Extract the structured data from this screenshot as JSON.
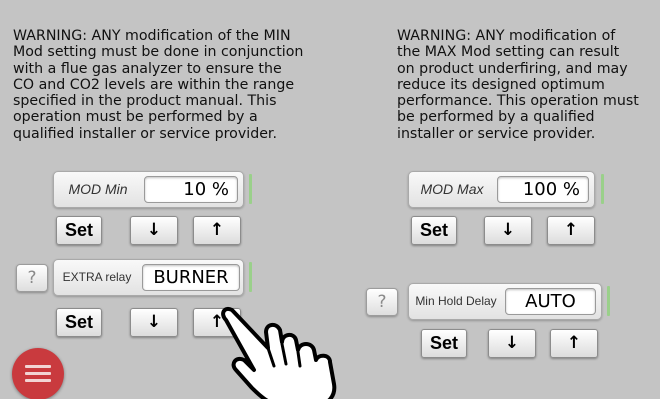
{
  "warnings": {
    "min": "WARNING: ANY modification of the MIN\nMod setting must be done in conjunction\nwith a flue gas analyzer to ensure the\nCO and CO2 levels are within the range\nspecified in the product manual. This\noperation must be performed by a\nqualified installer or service provider.",
    "max": "WARNING: ANY modification of\nthe MAX Mod setting can result\non product underfiring, and may\nreduce its designed optimum\nperformance. This operation must\nbe performed by a qualified\ninstaller or service provider."
  },
  "mod_min": {
    "label": "MOD Min",
    "value": "10 %"
  },
  "mod_max": {
    "label": "MOD Max",
    "value": "100 %"
  },
  "extra_relay": {
    "label": "EXTRA relay",
    "value": "BURNER"
  },
  "min_hold_delay": {
    "label": "Min Hold Delay",
    "value": "AUTO"
  },
  "buttons": {
    "set": "Set",
    "down": "↓",
    "up": "↑",
    "help": "?"
  },
  "icons": {
    "menu": "hamburger-menu-icon",
    "cursor": "pointing-hand-cursor-icon"
  },
  "colors": {
    "menu_button": "#c93a3e",
    "indicator": "#9ad08a",
    "background": "#c4c4c4"
  }
}
